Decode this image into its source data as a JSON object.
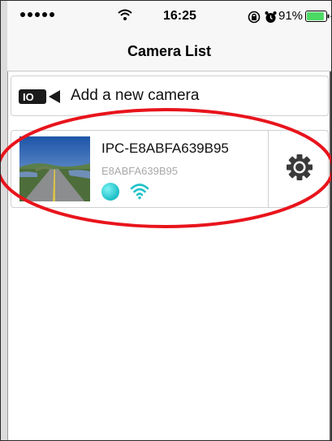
{
  "status_bar": {
    "time": "16:25",
    "battery_percent": "91%",
    "battery_level": 0.91,
    "icons": [
      "signal-dots-icon",
      "wifi-icon",
      "orientation-lock-icon",
      "alarm-icon",
      "battery-icon",
      "charging-icon"
    ]
  },
  "nav": {
    "title": "Camera List"
  },
  "add_camera": {
    "label": "Add a new camera",
    "icon": "video-camera-icon"
  },
  "cameras": [
    {
      "name": "IPC-E8ABFA639B95",
      "id": "E8ABFA639B95",
      "online_color": "#21c2c9",
      "wifi_color": "#21c2c9",
      "settings_icon": "gear-icon"
    }
  ],
  "annotation": {
    "color": "#e8141c",
    "shape": "ellipse"
  }
}
